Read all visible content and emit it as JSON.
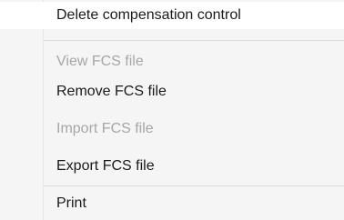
{
  "context_menu": {
    "items": [
      {
        "label": "Delete compensation control",
        "enabled": true
      },
      {
        "label": "View FCS file",
        "enabled": false
      },
      {
        "label": "Remove FCS file",
        "enabled": true
      },
      {
        "label": "Import FCS file",
        "enabled": false
      },
      {
        "label": "Export FCS file",
        "enabled": true
      },
      {
        "label": "Print",
        "enabled": true
      }
    ]
  }
}
